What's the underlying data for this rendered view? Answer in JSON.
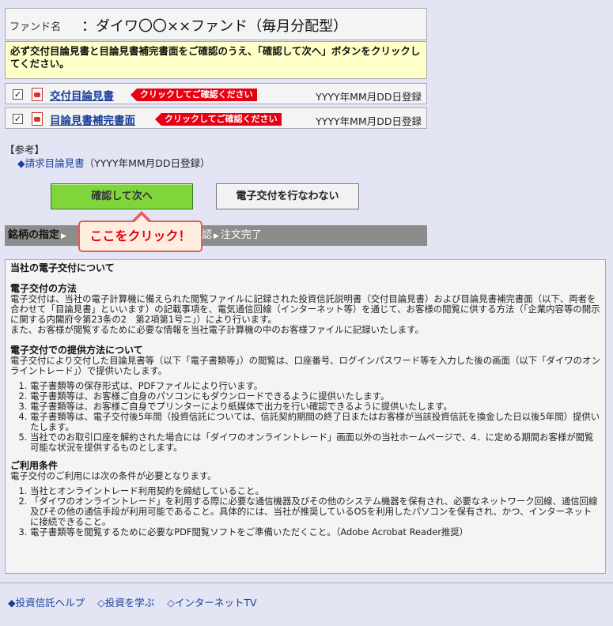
{
  "fund": {
    "label": "ファンド名",
    "value": "：ダイワ〇〇××ファンド（毎月分配型）"
  },
  "notice": "必ず交付目論見書と目論見書補完書面をご確認のうえ、「確認して次へ」ボタンをクリックしてください。",
  "documents": [
    {
      "check": "✓",
      "title": "交付目論見書",
      "tag": "クリックしてご確認ください",
      "date": "YYYY年MM月DD日登録"
    },
    {
      "check": "✓",
      "title": "目論見書補完書面",
      "tag": "クリックしてご確認ください",
      "date": "YYYY年MM月DD日登録"
    }
  ],
  "reference": {
    "heading": "【参考】",
    "link_icon": "◆",
    "link": "請求目論見書",
    "link_suffix": "（YYYY年MM月DD日登録）"
  },
  "buttons": {
    "confirm": "確認して次へ",
    "decline": "電子交付を行なわない"
  },
  "steps": {
    "current": "銘柄の指定",
    "hidden_part": "▶",
    "confirm": "確認",
    "order_done": "注文完了",
    "arrow": "▶"
  },
  "callout": "ここをクリック！",
  "info": {
    "title": "当社の電子交付について",
    "method_heading": "電子交付の方法",
    "method_text1": "電子交付は、当社の電子計算機に備えられた閲覧ファイルに記録された投資信託説明書（交付目論見書）および目論見書補完書面（以下、両者を合わせて「目論見書」といいます）の記載事項を、電気通信回線（インターネット等）を通じて、お客様の閲覧に供する方法（「企業内容等の開示に関する内閣府令第23条の2　第2項第1号ニ」）により行います。",
    "method_text2": "また、お客様が閲覧するために必要な情報を当社電子計算機の中のお客様ファイルに記録いたします。",
    "provide_heading": "電子交付での提供方法について",
    "provide_text": "電子交付により交付した目論見書等（以下「電子書類等」）の閲覧は、口座番号、ログインパスワード等を入力した後の画面（以下「ダイワのオンライントレード」）で提供いたします。",
    "provide_items": [
      "電子書類等の保存形式は、PDFファイルにより行います。",
      "電子書類等は、お客様ご自身のパソコンにもダウンロードできるように提供いたします。",
      "電子書類等は、お客様ご自身でプリンターにより紙媒体で出力を行い確認できるように提供いたします。",
      "電子書類等は、電子交付後5年間（投資信託については、信託契約期間の終了日またはお客様が当該投資信託を換金した日以後5年間）提供いたします。",
      "当社でのお取引口座を解約された場合には「ダイワのオンライントレード」画面以外の当社ホームページで、4．に定める期間お客様が閲覧可能な状況を提供するものとします。"
    ],
    "terms_heading": "ご利用条件",
    "terms_text": "電子交付のご利用には次の条件が必要となります。",
    "terms_items": [
      "当社とオンライントレード利用契約を締結していること。",
      "「ダイワのオンライントレード」を利用する際に必要な通信機器及びその他のシステム機器を保有され、必要なネットワーク回線、通信回線及びその他の通信手段が利用可能であること。具体的には、当社が推奨しているOSを利用したパソコンを保有され、かつ、インターネットに接続できること。",
      "電子書類等を閲覧するために必要なPDF閲覧ソフトをご準備いただくこと。（Adobe Acrobat Reader推奨）"
    ]
  },
  "footer": {
    "link1": "◆投資信託ヘルプ",
    "link2": "◇投資を学ぶ",
    "link3": "◇インターネットTV"
  }
}
